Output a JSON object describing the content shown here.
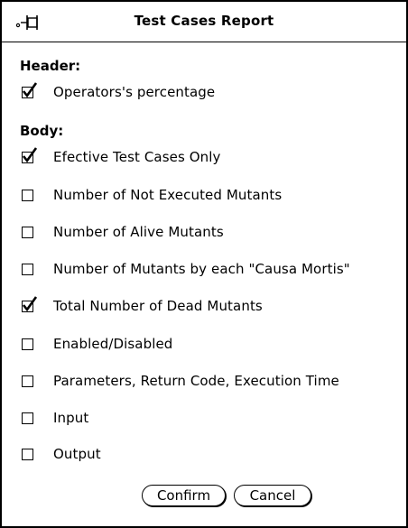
{
  "window": {
    "title": "Test Cases Report"
  },
  "header_section": {
    "label": "Header:",
    "items": [
      {
        "label": "Operators's percentage",
        "checked": true
      }
    ]
  },
  "body_section": {
    "label": "Body:",
    "items": [
      {
        "label": "Efective Test Cases Only",
        "checked": true
      },
      {
        "label": "Number of Not Executed Mutants",
        "checked": false
      },
      {
        "label": "Number of Alive Mutants",
        "checked": false
      },
      {
        "label": "Number of Mutants by each \"Causa Mortis\"",
        "checked": false
      },
      {
        "label": "Total Number of Dead Mutants",
        "checked": true
      },
      {
        "label": "Enabled/Disabled",
        "checked": false
      },
      {
        "label": "Parameters, Return Code, Execution Time",
        "checked": false
      },
      {
        "label": "Input",
        "checked": false
      },
      {
        "label": "Output",
        "checked": false
      }
    ]
  },
  "buttons": {
    "confirm_label": "Confirm",
    "cancel_label": "Cancel"
  },
  "icons": {
    "pin": "pushpin-icon",
    "check": "checkmark-icon"
  }
}
